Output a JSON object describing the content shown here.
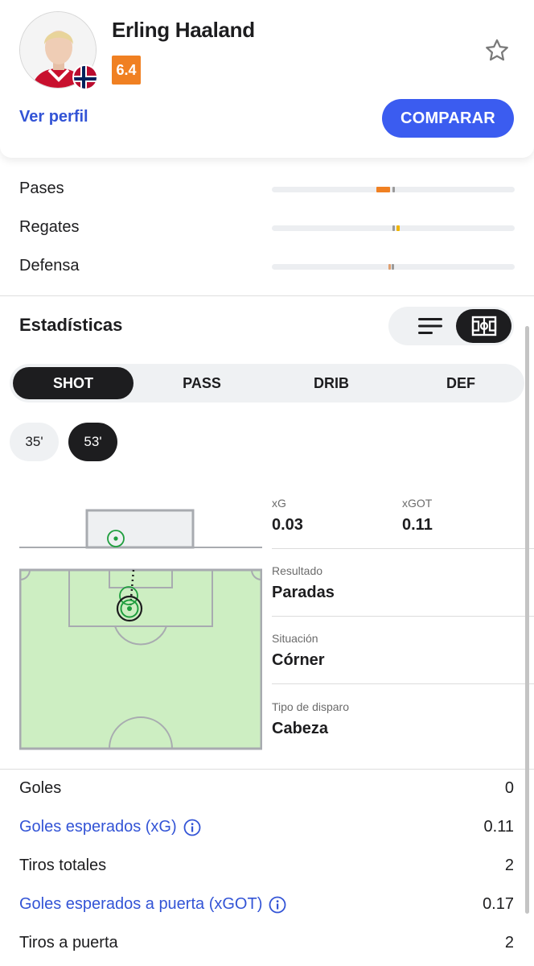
{
  "player": {
    "name": "Erling Haaland",
    "rating": "6.4",
    "view_profile": "Ver perfil",
    "compare_label": "COMPARAR"
  },
  "ratings": [
    {
      "label": "Pases",
      "value_marker": 0.46,
      "avg_marker": 0.5,
      "color": "#f08022"
    },
    {
      "label": "Regates",
      "value_marker": 0.52,
      "avg_marker": 0.5,
      "color": "#f0b400"
    },
    {
      "label": "Defensa",
      "value_marker": 0.49,
      "avg_marker": 0.5,
      "color": "#e0a070"
    }
  ],
  "stats": {
    "title": "Estadísticas",
    "tabs": [
      {
        "label": "SHOT",
        "active": true
      },
      {
        "label": "PASS",
        "active": false
      },
      {
        "label": "DRIB",
        "active": false
      },
      {
        "label": "DEF",
        "active": false
      }
    ],
    "minutes": [
      {
        "label": "35'",
        "active": false
      },
      {
        "label": "53'",
        "active": true
      }
    ]
  },
  "shot_detail": {
    "xg_label": "xG",
    "xg_value": "0.03",
    "xgot_label": "xGOT",
    "xgot_value": "0.11",
    "result_label": "Resultado",
    "result_value": "Paradas",
    "situation_label": "Situación",
    "situation_value": "Córner",
    "shot_type_label": "Tipo de disparo",
    "shot_type_value": "Cabeza"
  },
  "summary": [
    {
      "label": "Goles",
      "value": "0",
      "link": false
    },
    {
      "label": "Goles esperados (xG)",
      "value": "0.11",
      "link": true
    },
    {
      "label": "Tiros totales",
      "value": "2",
      "link": false
    },
    {
      "label": "Goles esperados a puerta (xGOT)",
      "value": "0.17",
      "link": true
    },
    {
      "label": "Tiros a puerta",
      "value": "2",
      "link": false
    }
  ],
  "colors": {
    "accent": "#3b5cf0",
    "link": "#3354d6",
    "rating_bg": "#f08022",
    "pitch": "#cdeec2",
    "shot_marker": "#1f9e3e"
  },
  "icons": [
    "star-icon",
    "list-view-icon",
    "pitch-view-icon",
    "info-icon"
  ]
}
